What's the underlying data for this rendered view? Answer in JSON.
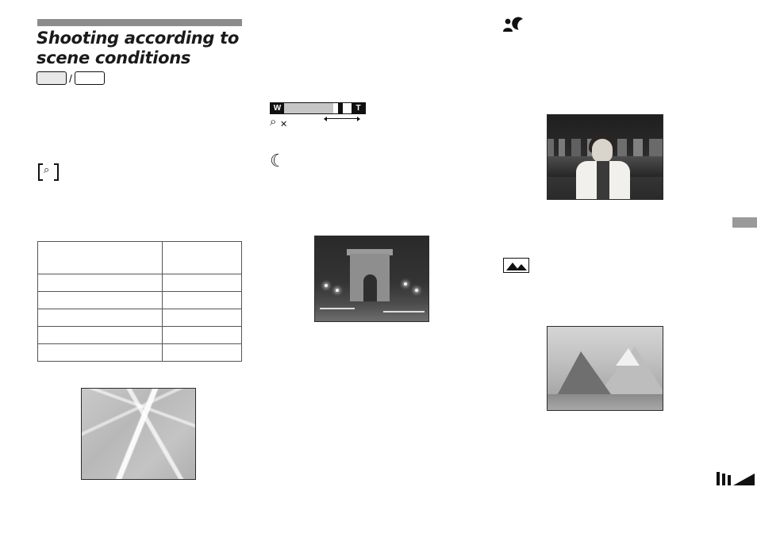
{
  "page": {
    "title_line1": "Shooting according to",
    "title_line2": "scene conditions",
    "mode_separator": "/"
  },
  "icons": {
    "soft_snap": "soft-snap-icon",
    "magnifier": "magnifier-icon",
    "magnifier_close": "magnifier-close-icon",
    "magnifier_glyph": "⌕",
    "close_glyph": "✕",
    "twilight_moon": "☾",
    "twilight_portrait": "twilight-portrait-icon",
    "landscape": "landscape-icon",
    "tab_mark": "page-tab-marker",
    "corner_mark": "page-corner-marker"
  },
  "zoom_bar": {
    "wide_label": "W",
    "tele_label": "T",
    "fill_percent": 72,
    "marker_percent": 79
  },
  "table": {
    "columns": [
      "",
      ""
    ],
    "rows": [
      [
        "",
        ""
      ],
      [
        "",
        ""
      ],
      [
        "",
        ""
      ],
      [
        "",
        ""
      ],
      [
        "",
        ""
      ],
      [
        "",
        ""
      ]
    ]
  },
  "photos": {
    "leaf": "macro-leaf-photo",
    "night": "twilight-monument-photo",
    "portrait": "twilight-portrait-photo",
    "landscape": "landscape-mountain-photo"
  }
}
